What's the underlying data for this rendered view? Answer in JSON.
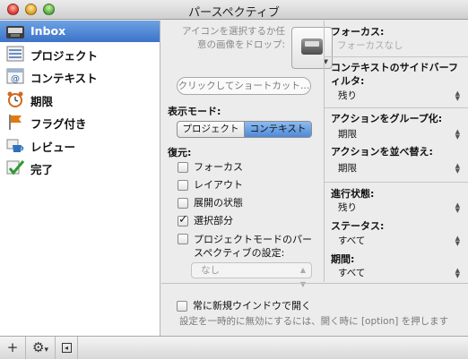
{
  "window": {
    "title": "パースペクティブ"
  },
  "sidebar": {
    "items": [
      {
        "label": "Inbox",
        "icon": "inbox-tray-icon",
        "selected": true
      },
      {
        "label": "プロジェクト",
        "icon": "projects-icon"
      },
      {
        "label": "コンテキスト",
        "icon": "contexts-icon"
      },
      {
        "label": "期限",
        "icon": "due-alarm-clock-icon"
      },
      {
        "label": "フラグ付き",
        "icon": "flag-icon"
      },
      {
        "label": "レビュー",
        "icon": "review-cup-icon"
      },
      {
        "label": "完了",
        "icon": "completed-checkmark-icon"
      }
    ]
  },
  "bottom_bar": {
    "add": "+",
    "gear": "⚙",
    "gear_arrow": "▾",
    "collapse": "◂"
  },
  "middle": {
    "drop_text": "アイコンを選択するか任意の画像をドロップ:",
    "shortcut_placeholder": "クリックしてショートカット…",
    "view_mode_label": "表示モード:",
    "view_modes": [
      {
        "label": "プロジェクト",
        "active": false
      },
      {
        "label": "コンテキスト",
        "active": true
      }
    ],
    "restore_label": "復元:",
    "restore_options": [
      {
        "label": "フォーカス",
        "checked": false
      },
      {
        "label": "レイアウト",
        "checked": false
      },
      {
        "label": "展開の状態",
        "checked": false
      },
      {
        "label": "選択部分",
        "checked": true
      },
      {
        "label": "プロジェクトモードのパースペクティブの設定:",
        "checked": false
      }
    ],
    "project_mode_select": "なし"
  },
  "right": {
    "focus_label": "フォーカス:",
    "focus_placeholder": "フォーカスなし",
    "context_filter_label": "コンテキストのサイドバーフィルタ:",
    "context_filter_value": "残り",
    "group_label": "アクションをグループ化:",
    "group_value": "期限",
    "sort_label": "アクションを並べ替え:",
    "sort_value": "期限",
    "progress_label": "進行状態:",
    "progress_value": "残り",
    "status_label": "ステータス:",
    "status_value": "すべて",
    "period_label": "期間:",
    "period_value": "すべて"
  },
  "footer": {
    "new_window_label": "常に新規ウインドウで開く",
    "new_window_checked": false,
    "note": "設定を一時的に無効にするには、開く時に [option] を押します"
  },
  "colors": {
    "selection": "#3c73c9",
    "segment_active": "#5f95dc"
  }
}
